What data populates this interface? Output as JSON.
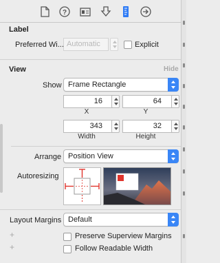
{
  "toolbar": {
    "icons": [
      "file-inspector-icon",
      "quick-help-icon",
      "identity-inspector-icon",
      "attributes-inspector-icon",
      "size-inspector-icon",
      "connections-inspector-icon"
    ],
    "active_color": "#2f7bf5"
  },
  "label_section": {
    "title": "Label",
    "preferred_width_label": "Preferred Wi...",
    "preferred_width_placeholder": "Automatic",
    "explicit_label": "Explicit"
  },
  "view_section": {
    "title": "View",
    "hide_label": "Hide",
    "show_label": "Show",
    "show_value": "Frame Rectangle",
    "x_value": "16",
    "x_label": "X",
    "y_value": "64",
    "y_label": "Y",
    "width_value": "343",
    "width_label": "Width",
    "height_value": "32",
    "height_label": "Height",
    "arrange_label": "Arrange",
    "arrange_value": "Position View",
    "autoresizing_label": "Autoresizing"
  },
  "layout": {
    "layout_margins_label": "Layout Margins",
    "layout_margins_value": "Default",
    "preserve_superview_margins": "Preserve Superview Margins",
    "follow_readable_width": "Follow Readable Width"
  },
  "colors": {
    "accent": "#3a86f6",
    "autoresizing_red": "#e0342c",
    "hide_link": "#a9a9a9"
  }
}
